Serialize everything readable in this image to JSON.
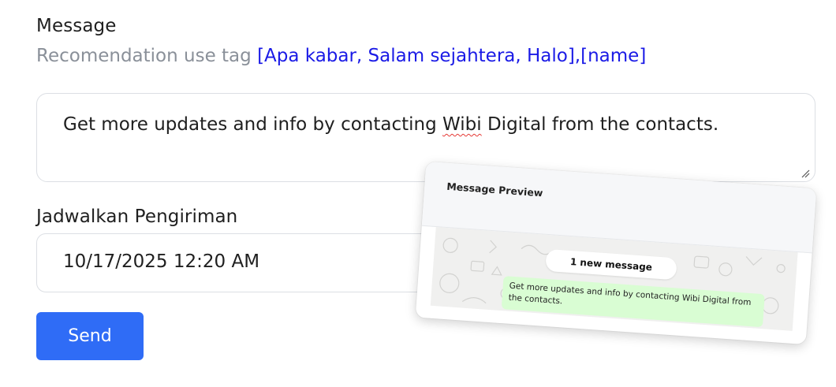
{
  "form": {
    "message_label": "Message",
    "hint_prefix": "Recomendation use tag ",
    "hint_tags": "[Apa kabar, Salam sejahtera, Halo],[name]",
    "message_before": "Get more updates and info by contacting ",
    "message_misspelled": "Wibi",
    "message_after": " Digital from the contacts.",
    "schedule_label": "Jadwalkan Pengiriman",
    "schedule_value": "10/17/2025 12:20  AM",
    "send_label": "Send"
  },
  "preview": {
    "title": "Message Preview",
    "notification": "1 new message",
    "bubble_text": "Get more updates and info by contacting Wibi Digital from the contacts."
  },
  "colors": {
    "accent": "#2f6cf6",
    "tag_blue": "#1a1ae6",
    "hint_gray": "#8a9099",
    "bubble_green": "#d9fdd3"
  }
}
